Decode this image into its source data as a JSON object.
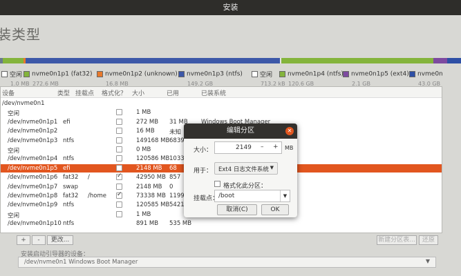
{
  "window": {
    "title": "安装"
  },
  "page": {
    "heading": "装类型"
  },
  "partition_bar": {
    "colors": [
      "#6b7a8e",
      "#84b43c",
      "#e8792c",
      "#3d58a8",
      "#e5e5e3",
      "#84b43c",
      "#7d4aa0",
      "#2e4fa5"
    ]
  },
  "legend": [
    {
      "name": "空闲",
      "size": "1.0 MB",
      "color": "#ffffff"
    },
    {
      "name": "nvme0n1p1 (fat32)",
      "size": "272.6 MB",
      "color": "#84b43c"
    },
    {
      "name": "nvme0n1p2 (unknown)",
      "size": "16.8 MB",
      "color": "#e8792c"
    },
    {
      "name": "nvme0n1p3 (ntfs)",
      "size": "149.2 GB",
      "color": "#3d58a8"
    },
    {
      "name": "空闲",
      "size": "713.2 kB",
      "color": "#ffffff"
    },
    {
      "name": "nvme0n1p4 (ntfs)",
      "size": "120.6 GB",
      "color": "#84b43c"
    },
    {
      "name": "nvme0n1p5 (ext4)",
      "size": "2.1 GB",
      "color": "#7d4aa0"
    },
    {
      "name": "nvme0n",
      "size": "43.0 GB",
      "color": "#2e4fa5"
    }
  ],
  "table": {
    "headers": [
      "设备",
      "类型",
      "挂载点",
      "格式化？",
      "大小",
      "已用",
      "已装系统"
    ],
    "rows": [
      {
        "device": "/dev/nvme0n1",
        "type": "",
        "mount": "",
        "format": false,
        "show_check": false,
        "size": "",
        "used": "",
        "system": ""
      },
      {
        "device": "空闲",
        "type": "",
        "mount": "",
        "format": false,
        "show_check": true,
        "size": "1 MB",
        "used": "",
        "system": ""
      },
      {
        "device": "/dev/nvme0n1p1",
        "type": "efi",
        "mount": "",
        "format": false,
        "show_check": true,
        "size": "272 MB",
        "used": "31 MB",
        "system": "Windows Boot Manager"
      },
      {
        "device": "/dev/nvme0n1p2",
        "type": "",
        "mount": "",
        "format": false,
        "show_check": true,
        "size": "16 MB",
        "used": "未知",
        "system": ""
      },
      {
        "device": "/dev/nvme0n1p3",
        "type": "ntfs",
        "mount": "",
        "format": false,
        "show_check": true,
        "size": "149168 MB",
        "used": "68396",
        "system": ""
      },
      {
        "device": "空闲",
        "type": "",
        "mount": "",
        "format": false,
        "show_check": true,
        "size": "0 MB",
        "used": "",
        "system": ""
      },
      {
        "device": "/dev/nvme0n1p4",
        "type": "ntfs",
        "mount": "",
        "format": false,
        "show_check": true,
        "size": "120586 MB",
        "used": "10336",
        "system": ""
      },
      {
        "device": "/dev/nvme0n1p5",
        "type": "efi",
        "mount": "",
        "format": false,
        "show_check": true,
        "size": "2148 MB",
        "used": "68",
        "system": "",
        "selected": true
      },
      {
        "device": "/dev/nvme0n1p6",
        "type": "fat32",
        "mount": "/",
        "format": true,
        "show_check": true,
        "size": "42950 MB",
        "used": "857",
        "system": ""
      },
      {
        "device": "/dev/nvme0n1p7",
        "type": "swap",
        "mount": "",
        "format": false,
        "show_check": true,
        "size": "2148 MB",
        "used": "0",
        "system": ""
      },
      {
        "device": "/dev/nvme0n1p8",
        "type": "fat32",
        "mount": "/home",
        "format": true,
        "show_check": true,
        "size": "73338 MB",
        "used": "1199",
        "system": ""
      },
      {
        "device": "/dev/nvme0n1p9",
        "type": "ntfs",
        "mount": "",
        "format": false,
        "show_check": true,
        "size": "120585 MB",
        "used": "54214",
        "system": ""
      },
      {
        "device": "空闲",
        "type": "",
        "mount": "",
        "format": false,
        "show_check": true,
        "size": "1 MB",
        "used": "",
        "system": ""
      },
      {
        "device": "/dev/nvme0n1p10",
        "type": "ntfs",
        "mount": "",
        "format": false,
        "show_check": false,
        "size": "891 MB",
        "used": "535 MB",
        "system": ""
      }
    ]
  },
  "toolbar": {
    "add_label": "+",
    "remove_label": "-",
    "change_label": "更改...",
    "new_table_label": "新建分区表...",
    "revert_label": "还原"
  },
  "boot": {
    "label": "安装启动引导器的设备：",
    "value": "/dev/nvme0n1     Windows Boot Manager"
  },
  "dialog": {
    "title": "编辑分区",
    "size_label": "大小：",
    "size_value": "2149",
    "size_unit": "MB",
    "use_label": "用于：",
    "use_value": "Ext4 日志文件系统",
    "format_label": "格式化此分区：",
    "mount_label": "挂载点：",
    "mount_value": "/boot",
    "cancel_label": "取消(C)",
    "ok_label": "OK"
  }
}
